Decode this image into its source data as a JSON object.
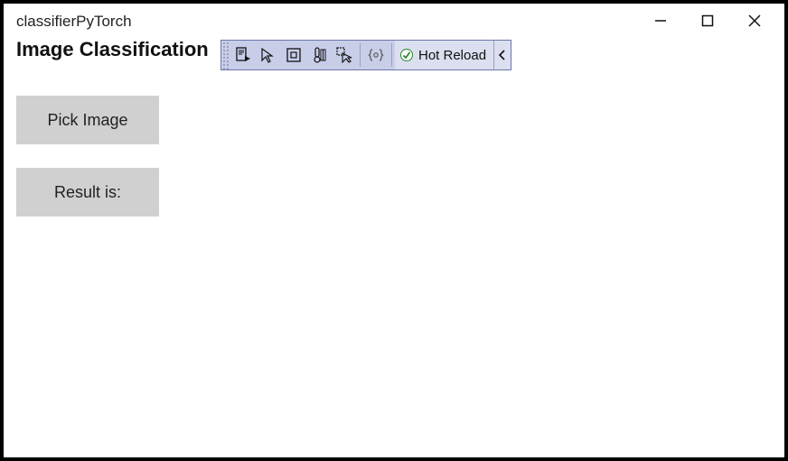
{
  "window": {
    "title": "classifierPyTorch"
  },
  "header": {
    "heading": "Image Classification"
  },
  "debug_toolbar": {
    "hot_reload_label": "Hot Reload"
  },
  "buttons": {
    "pick_image": "Pick Image",
    "result_label": "Result is:"
  }
}
